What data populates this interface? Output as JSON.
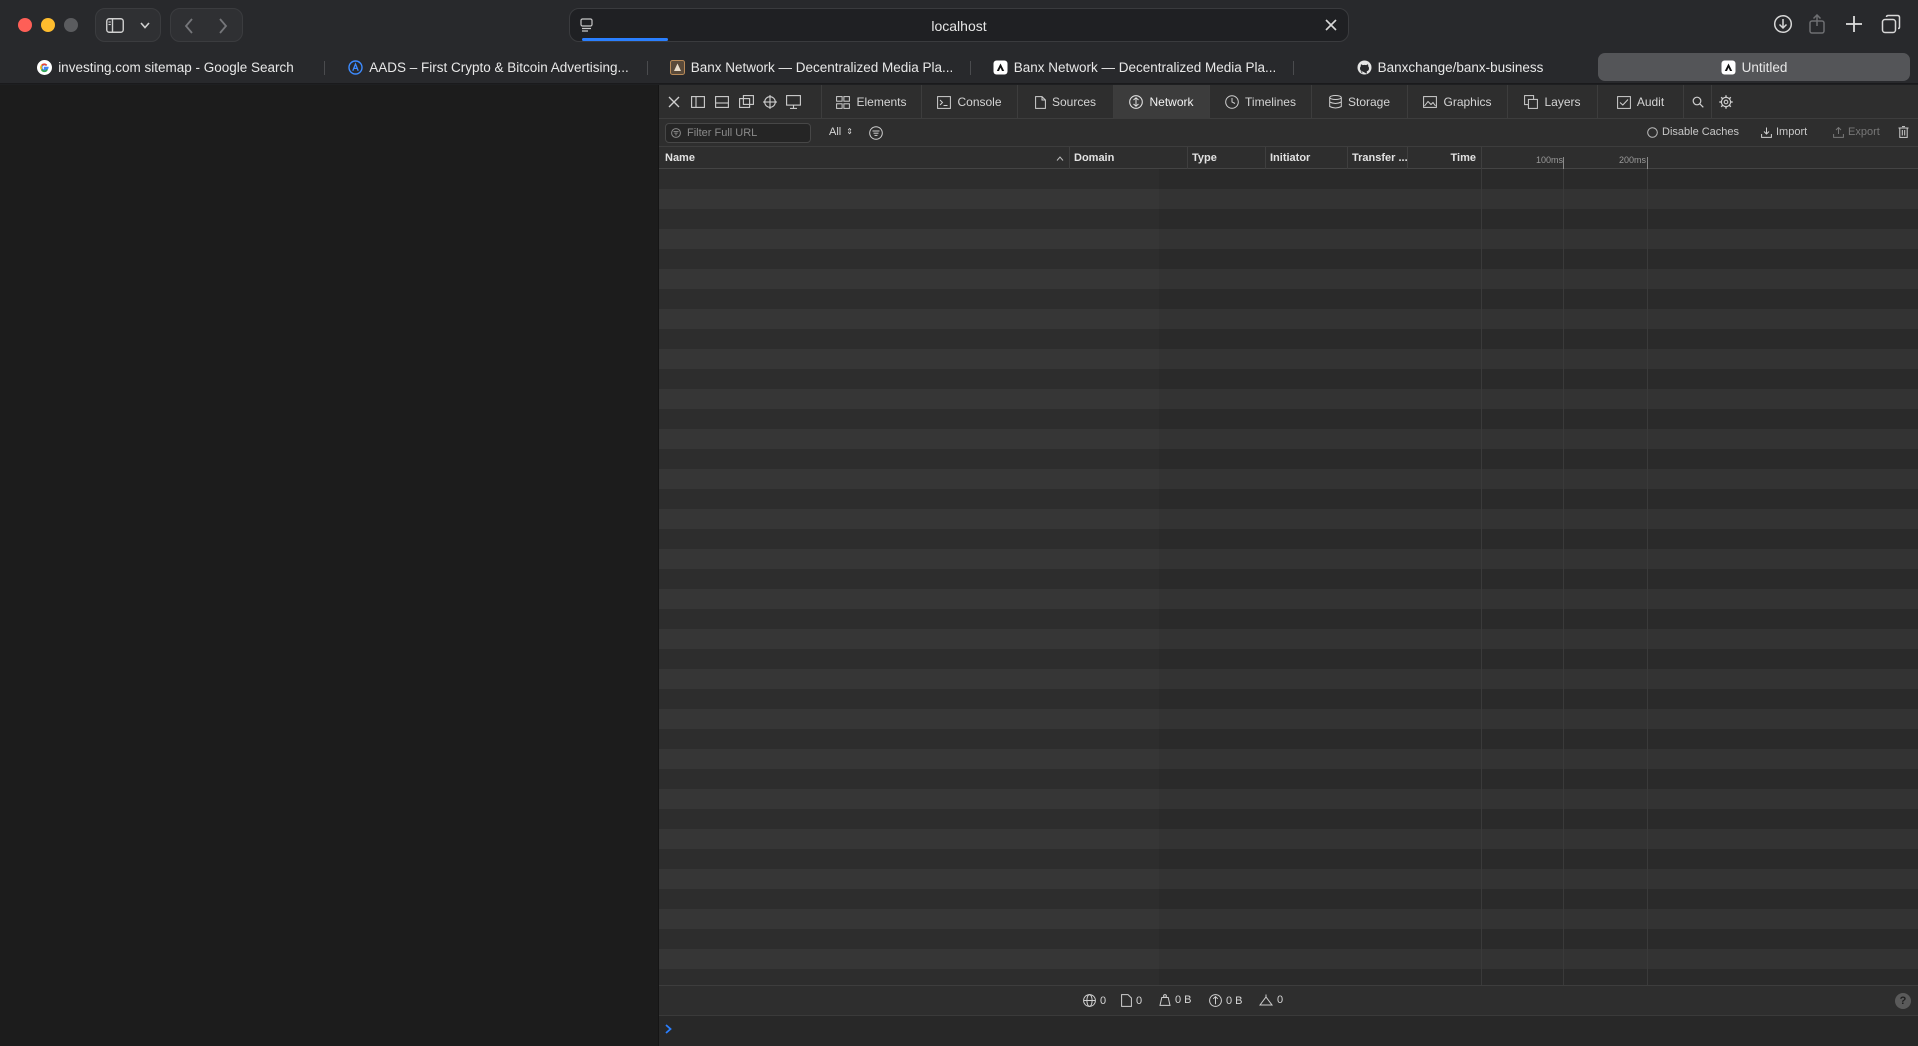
{
  "browser": {
    "url": "localhost",
    "tabs": [
      {
        "label": "investing.com sitemap - Google Search",
        "icon": "google-icon"
      },
      {
        "label": "AADS – First Crypto & Bitcoin Advertising...",
        "icon": "aads-icon"
      },
      {
        "label": "Banx Network — Decentralized Media Pla...",
        "icon": "banx-icon"
      },
      {
        "label": "Banx Network — Decentralized Media Pla...",
        "icon": "banx-icon"
      },
      {
        "label": "Banxchange/banx-business",
        "icon": "github-icon"
      },
      {
        "label": "Untitled",
        "icon": "banx-icon",
        "active": true
      }
    ]
  },
  "inspector": {
    "tabs": [
      {
        "label": "Elements",
        "icon": "elements-icon"
      },
      {
        "label": "Console",
        "icon": "console-icon"
      },
      {
        "label": "Sources",
        "icon": "sources-icon"
      },
      {
        "label": "Network",
        "icon": "network-icon",
        "selected": true
      },
      {
        "label": "Timelines",
        "icon": "timelines-icon"
      },
      {
        "label": "Storage",
        "icon": "storage-icon"
      },
      {
        "label": "Graphics",
        "icon": "graphics-icon"
      },
      {
        "label": "Layers",
        "icon": "layers-icon"
      },
      {
        "label": "Audit",
        "icon": "audit-icon"
      }
    ],
    "filter": {
      "placeholder": "Filter Full URL",
      "type_select": "All",
      "disable_caches": "Disable Caches",
      "import": "Import",
      "export": "Export"
    },
    "columns": {
      "name": "Name",
      "domain": "Domain",
      "type": "Type",
      "initiator": "Initiator",
      "transfer": "Transfer ...",
      "time": "Time",
      "tick1": "100ms",
      "tick2": "200ms"
    },
    "status": {
      "requests": "0",
      "resources": "0",
      "resource_size": "0 B",
      "transferred": "0 B",
      "redirects": "0"
    }
  },
  "colors": {
    "accent": "#2a7fff",
    "close": "#fe5f57",
    "minimize": "#febc2e"
  }
}
